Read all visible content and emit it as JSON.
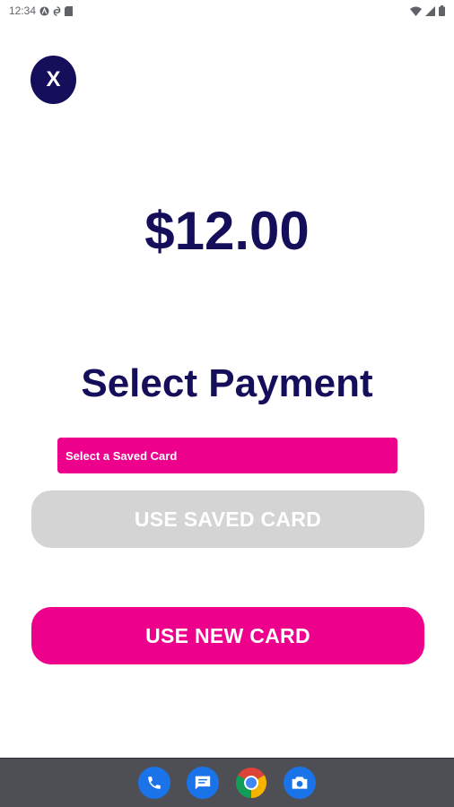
{
  "status_bar": {
    "time": "12:34",
    "left_icons": [
      "android-auto-icon",
      "sync-icon",
      "sd-card-icon"
    ],
    "right_icons": [
      "wifi-icon",
      "signal-icon",
      "battery-icon"
    ]
  },
  "close_button": {
    "label": "X"
  },
  "amount": "$12.00",
  "heading": "Select Payment",
  "saved_card_select": {
    "value": "Select a Saved Card"
  },
  "buttons": {
    "use_saved_card": "USE SAVED CARD",
    "use_new_card": "USE NEW CARD"
  },
  "dock": {
    "apps": [
      "phone-icon",
      "messages-icon",
      "chrome-icon",
      "camera-icon"
    ]
  },
  "colors": {
    "primary_navy": "#150e5b",
    "accent_pink": "#ec008c",
    "disabled_gray": "#d4d4d4",
    "nav_bar": "#4e4f55"
  }
}
